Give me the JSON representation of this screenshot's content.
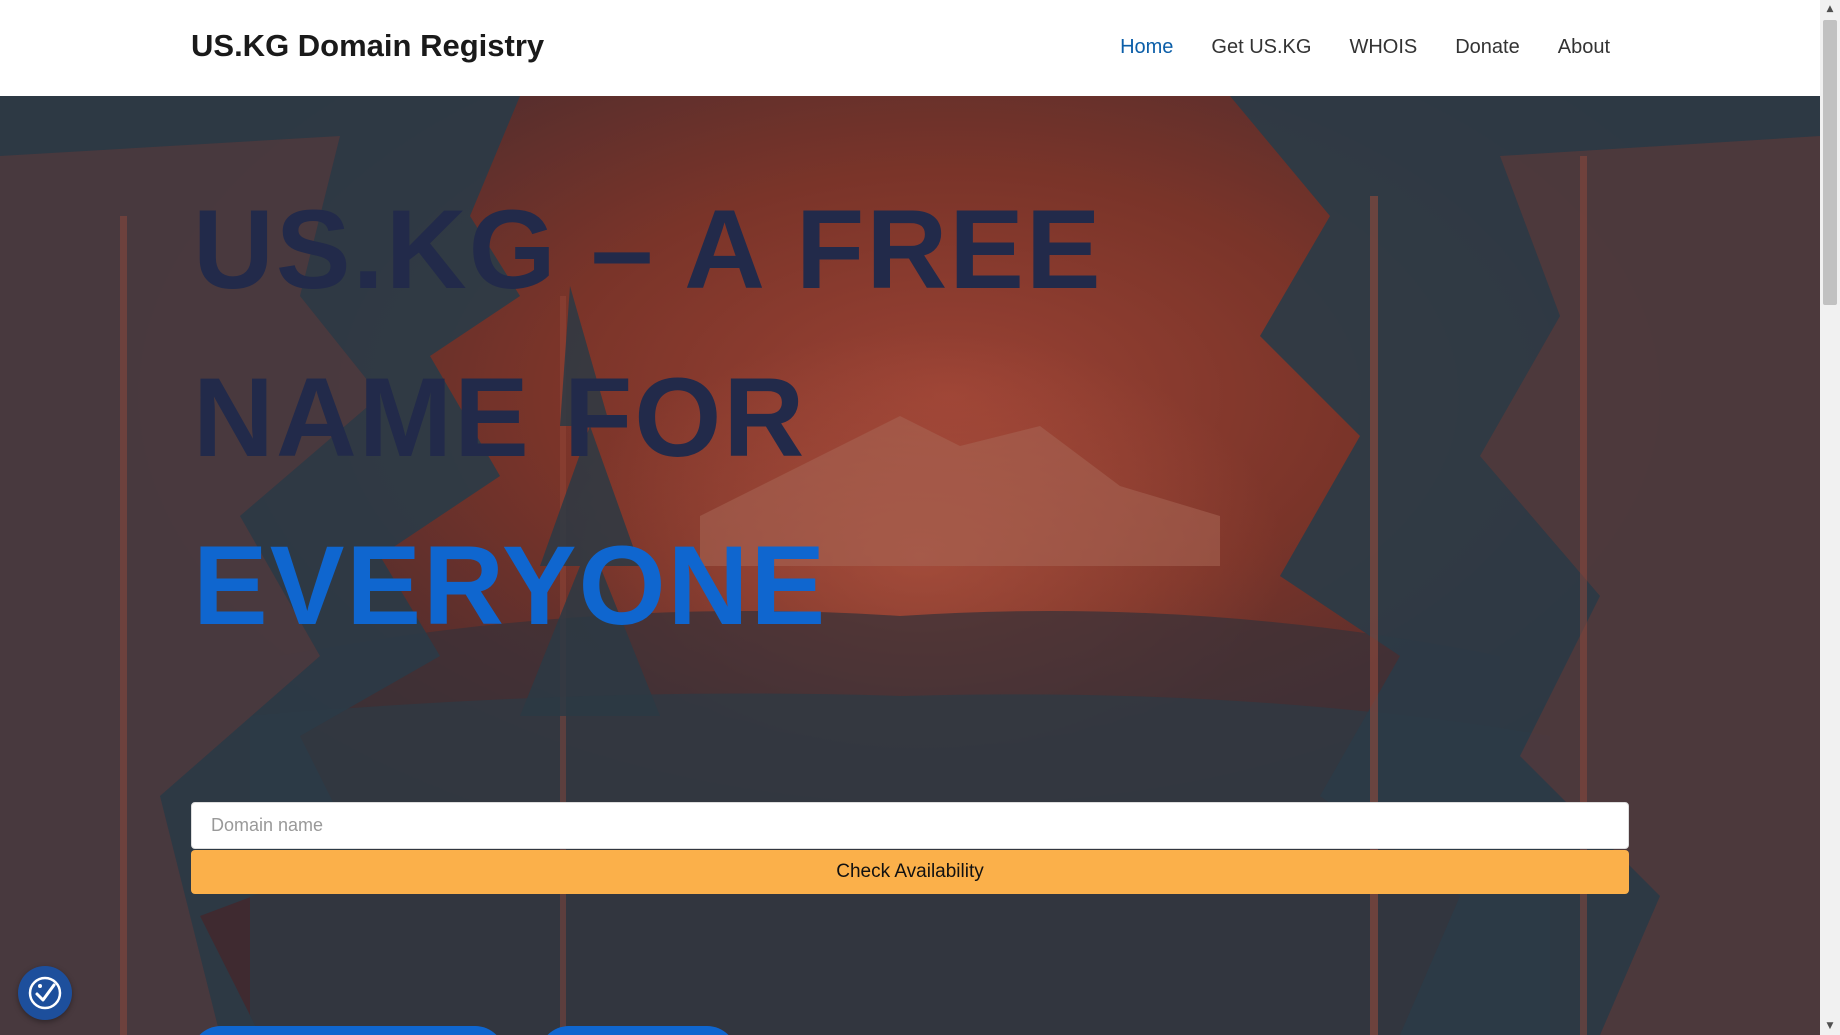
{
  "header": {
    "brand": "US.KG Domain Registry",
    "nav": [
      {
        "label": "Home",
        "active": true
      },
      {
        "label": "Get US.KG",
        "active": false
      },
      {
        "label": "WHOIS",
        "active": false
      },
      {
        "label": "Donate",
        "active": false
      },
      {
        "label": "About",
        "active": false
      }
    ]
  },
  "hero": {
    "title_line1": "US.KG – A FREE",
    "title_line2": "NAME FOR",
    "title_accent": "EVERYONE"
  },
  "search": {
    "placeholder": "Domain name",
    "value": "",
    "button_label": "Check Availability"
  },
  "colors": {
    "accent": "#0f66cf",
    "button": "#fbb04a",
    "nav_active": "#0b5ea8"
  },
  "icons": {
    "accessibility": "accessibility-icon"
  }
}
